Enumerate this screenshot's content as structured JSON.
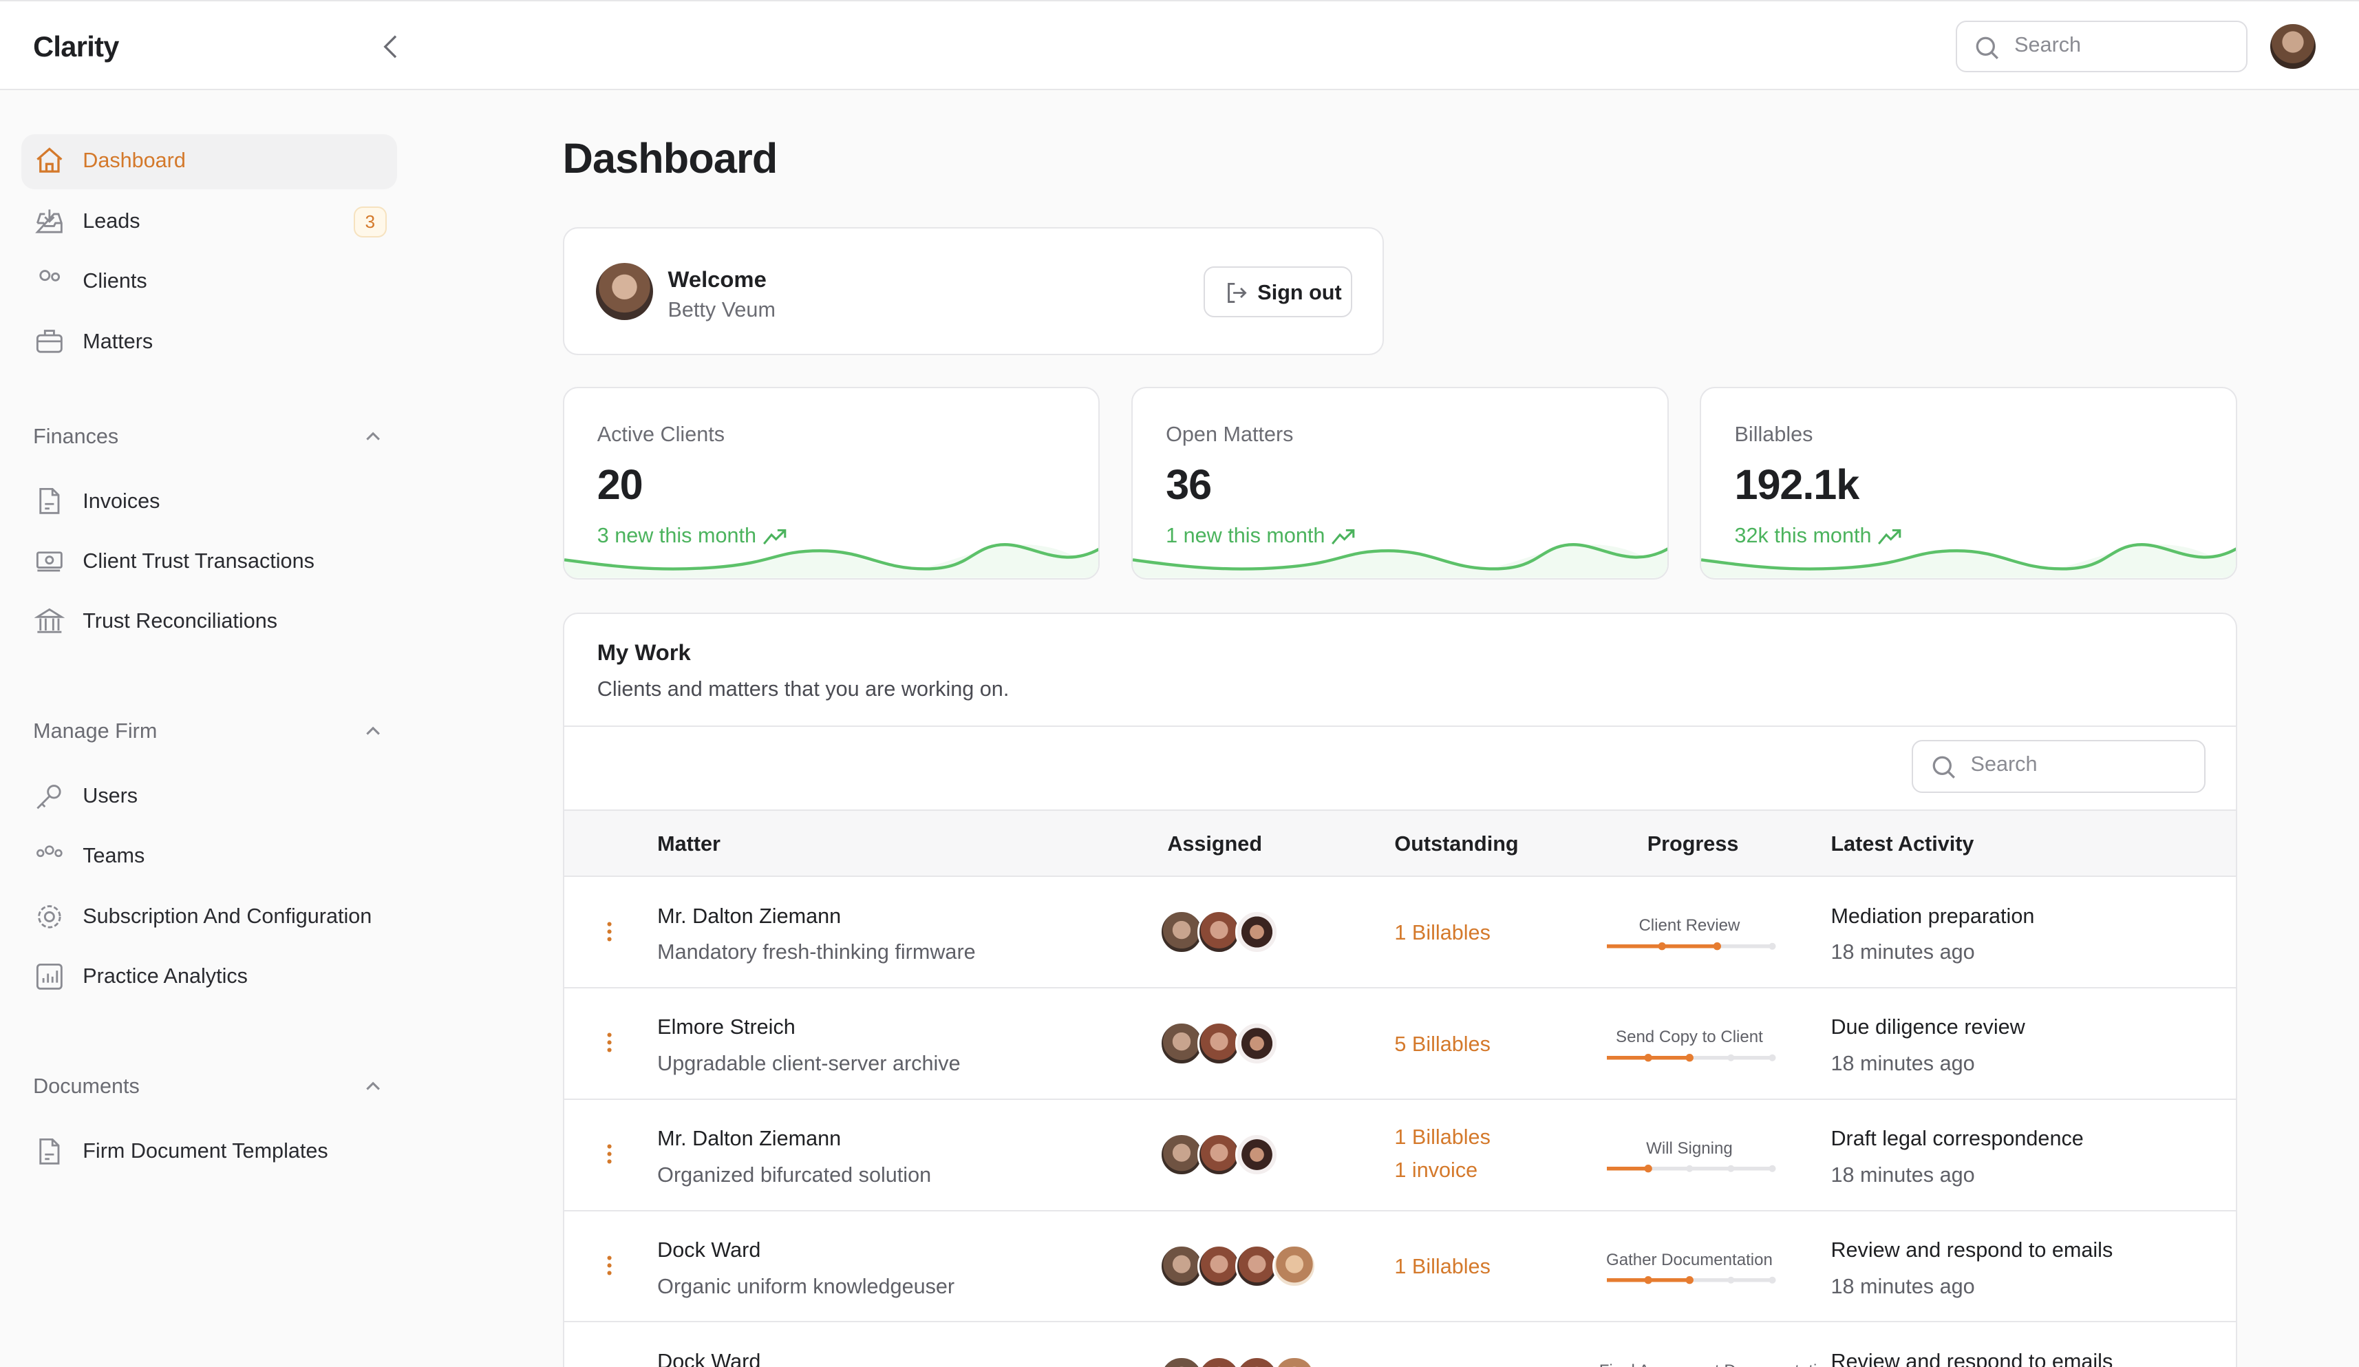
{
  "app": {
    "title": "Clarity"
  },
  "header": {
    "search_placeholder": "Search"
  },
  "colors": {
    "accent": "#d4792b",
    "positive": "#4bb35d",
    "progress_done": "#e67c30",
    "progress_todo": "#e4e4e7"
  },
  "sidebar": {
    "main": [
      {
        "label": "Dashboard",
        "icon": "home-icon",
        "active": true
      },
      {
        "label": "Leads",
        "icon": "inbox-download-icon",
        "badge": "3"
      },
      {
        "label": "Clients",
        "icon": "users-icon"
      },
      {
        "label": "Matters",
        "icon": "briefcase-icon"
      }
    ],
    "sections": [
      {
        "title": "Finances",
        "items": [
          {
            "label": "Invoices",
            "icon": "document-icon"
          },
          {
            "label": "Client Trust Transactions",
            "icon": "cash-icon"
          },
          {
            "label": "Trust Reconciliations",
            "icon": "bank-icon"
          }
        ]
      },
      {
        "title": "Manage Firm",
        "items": [
          {
            "label": "Users",
            "icon": "key-icon"
          },
          {
            "label": "Teams",
            "icon": "team-icon"
          },
          {
            "label": "Subscription And Configuration",
            "icon": "gear-icon"
          },
          {
            "label": "Practice Analytics",
            "icon": "chart-icon"
          }
        ]
      },
      {
        "title": "Documents",
        "items": [
          {
            "label": "Firm Document Templates",
            "icon": "document-icon"
          }
        ]
      }
    ]
  },
  "page": {
    "title": "Dashboard"
  },
  "welcome": {
    "title": "Welcome",
    "name": "Betty Veum",
    "sign_out": "Sign out"
  },
  "stats": [
    {
      "label": "Active Clients",
      "value": "20",
      "delta": "3 new this month"
    },
    {
      "label": "Open Matters",
      "value": "36",
      "delta": "1 new this month"
    },
    {
      "label": "Billables",
      "value": "192.1k",
      "delta": "32k this month"
    }
  ],
  "my_work": {
    "title": "My Work",
    "subtitle": "Clients and matters that you are working on.",
    "search_placeholder": "Search",
    "columns": [
      "Matter",
      "Assigned",
      "Outstanding",
      "Progress",
      "Latest Activity"
    ],
    "rows": [
      {
        "client": "Mr. Dalton Ziemann",
        "matter": "Mandatory fresh-thinking firmware",
        "assigned": 3,
        "outstanding": [
          "1 Billables"
        ],
        "stage": "Client Review",
        "steps": 3,
        "completed": 2,
        "activity": "Mediation preparation",
        "time": "18 minutes ago"
      },
      {
        "client": "Elmore Streich",
        "matter": "Upgradable client-server archive",
        "assigned": 3,
        "outstanding": [
          "5 Billables"
        ],
        "stage": "Send Copy to Client",
        "steps": 4,
        "completed": 2,
        "activity": "Due diligence review",
        "time": "18 minutes ago"
      },
      {
        "client": "Mr. Dalton Ziemann",
        "matter": "Organized bifurcated solution",
        "assigned": 3,
        "outstanding": [
          "1 Billables",
          "1 invoice"
        ],
        "stage": "Will Signing",
        "steps": 4,
        "completed": 1,
        "activity": "Draft legal correspondence",
        "time": "18 minutes ago"
      },
      {
        "client": "Dock Ward",
        "matter": "Organic uniform knowledgeuser",
        "assigned": 4,
        "outstanding": [
          "1 Billables"
        ],
        "stage": "Gather Documentation",
        "steps": 4,
        "completed": 2,
        "activity": "Review and respond to emails",
        "time": "18 minutes ago"
      },
      {
        "client": "Dock Ward",
        "matter": "",
        "assigned": 4,
        "outstanding": [],
        "stage": "Final Agreement Documentation",
        "steps": 4,
        "completed": 2,
        "activity": "Review and respond to emails",
        "time": ""
      }
    ]
  }
}
